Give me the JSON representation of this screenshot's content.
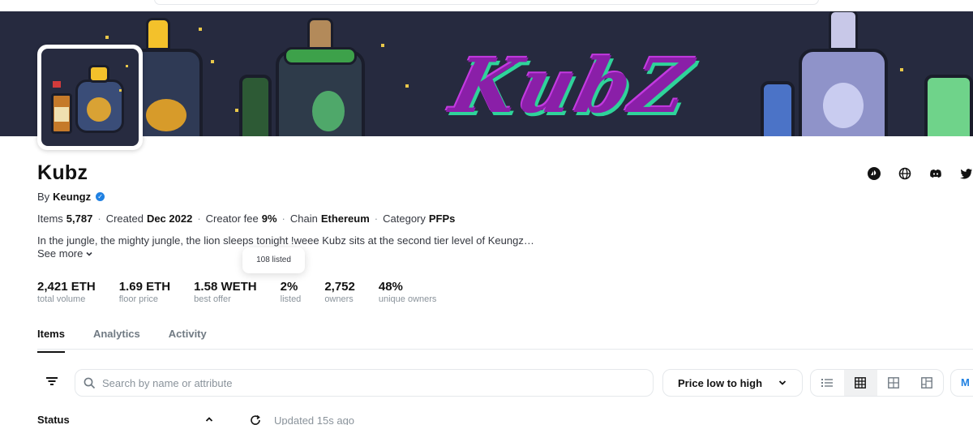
{
  "collection": {
    "name": "Kubz",
    "by_prefix": "By",
    "creator": "Keungz",
    "banner_logo_text": "KubZ",
    "meta": [
      {
        "label": "Items",
        "value": "5,787"
      },
      {
        "label": "Created",
        "value": "Dec 2022"
      },
      {
        "label": "Creator fee",
        "value": "9%"
      },
      {
        "label": "Chain",
        "value": "Ethereum"
      },
      {
        "label": "Category",
        "value": "PFPs"
      }
    ],
    "description": "In the jungle, the mighty jungle, the lion sleeps tonight !weee Kubz sits at the second tier level of Keungz…",
    "see_more": "See more"
  },
  "tooltip": "108 listed",
  "stats": [
    {
      "value": "2,421 ETH",
      "label": "total volume"
    },
    {
      "value": "1.69 ETH",
      "label": "floor price"
    },
    {
      "value": "1.58 WETH",
      "label": "best offer"
    },
    {
      "value": "2%",
      "label": "listed"
    },
    {
      "value": "2,752",
      "label": "owners"
    },
    {
      "value": "48%",
      "label": "unique owners"
    }
  ],
  "tabs": [
    {
      "label": "Items",
      "active": true
    },
    {
      "label": "Analytics",
      "active": false
    },
    {
      "label": "Activity",
      "active": false
    }
  ],
  "toolbar": {
    "search_placeholder": "Search by name or attribute",
    "sort_label": "Price low to high",
    "make_offer_label": "M"
  },
  "filters": {
    "status_label": "Status",
    "updated_text": "Updated 15s ago"
  },
  "icons": {
    "socials": [
      "opensea-icon",
      "globe-icon",
      "discord-icon",
      "twitter-icon"
    ],
    "views": [
      "list-view-icon",
      "grid-view-icon",
      "large-grid-view-icon",
      "mosaic-view-icon"
    ]
  },
  "colors": {
    "banner_bg": "#262a3f",
    "accent": "#2081e2",
    "logo_purple": "#8a1fa8",
    "logo_green": "#2fd39a"
  }
}
